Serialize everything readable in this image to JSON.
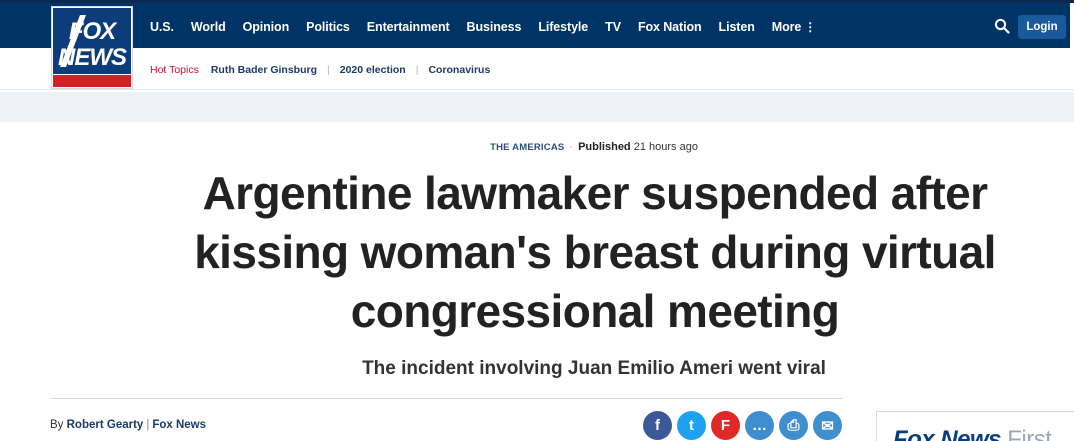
{
  "logo": {
    "line1": "FOX",
    "line2": "NEWS"
  },
  "nav": {
    "items": [
      "U.S.",
      "World",
      "Opinion",
      "Politics",
      "Entertainment",
      "Business",
      "Lifestyle",
      "TV",
      "Fox Nation",
      "Listen"
    ],
    "more_label": "More",
    "more_icon": "⋮",
    "login_label": "Login",
    "search_icon": "search-icon"
  },
  "hot_topics": {
    "label": "Hot Topics",
    "items": [
      "Ruth Bader Ginsburg",
      "2020 election",
      "Coronavirus"
    ]
  },
  "article": {
    "category": "THE AMERICAS",
    "published_label": "Published",
    "published_time": "21 hours ago",
    "headline_lines": [
      "Argentine lawmaker suspended after",
      "kissing woman's breast during virtual",
      "congressional meeting"
    ],
    "subheadline": "The incident involving Juan Emilio Ameri went viral",
    "byline_prefix": "By",
    "author": "Robert Gearty",
    "outlet": "Fox News"
  },
  "share": [
    {
      "name": "facebook-icon",
      "glyph": "f",
      "color": "#3b5998"
    },
    {
      "name": "twitter-icon",
      "glyph": "t",
      "color": "#1da1f2"
    },
    {
      "name": "flipboard-icon",
      "glyph": "F",
      "color": "#e12828"
    },
    {
      "name": "comment-icon",
      "glyph": "…",
      "color": "#3e8ed0"
    },
    {
      "name": "print-icon",
      "glyph": "⎙",
      "color": "#3e8ed0"
    },
    {
      "name": "email-icon",
      "glyph": "✉",
      "color": "#3e8ed0"
    }
  ],
  "side_promo": {
    "title": "Fox News",
    "title_rest": "First"
  },
  "colors": {
    "nav_bg": "#003366",
    "accent_red": "#c8102e",
    "headline": "#222222"
  }
}
